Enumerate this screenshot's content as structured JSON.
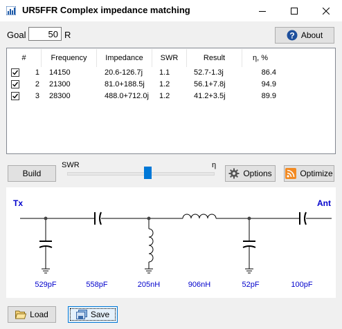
{
  "window": {
    "title": "UR5FFR Complex impedance matching",
    "app_icon": "bar-chart-icon"
  },
  "goal": {
    "label": "Goal",
    "value": "50",
    "unit": "R"
  },
  "about_button": {
    "label": "About",
    "icon": "help-icon"
  },
  "table": {
    "columns": [
      "#",
      "Frequency",
      "Impedance",
      "SWR",
      "Result",
      "η, %"
    ],
    "rows": [
      {
        "checked": true,
        "index": "1",
        "frequency": "14150",
        "impedance": "20.6-126.7j",
        "swr": "1.1",
        "result": "52.7-1.3j",
        "eta": "86.4"
      },
      {
        "checked": true,
        "index": "2",
        "frequency": "21300",
        "impedance": "81.0+188.5j",
        "swr": "1.2",
        "result": "56.1+7.8j",
        "eta": "94.9"
      },
      {
        "checked": true,
        "index": "3",
        "frequency": "28300",
        "impedance": "488.0+712.0j",
        "swr": "1.2",
        "result": "41.2+3.5j",
        "eta": "89.9"
      }
    ]
  },
  "controls": {
    "build_label": "Build",
    "swr_label": "SWR",
    "eta_label": "η",
    "slider_value": 0.55,
    "options_label": "Options",
    "options_icon": "gear-icon",
    "optimize_label": "Optimize",
    "optimize_icon": "rss-icon"
  },
  "schematic": {
    "tx_label": "Tx",
    "ant_label": "Ant",
    "components": [
      "529pF",
      "558pF",
      "205nH",
      "906nH",
      "52pF",
      "100pF"
    ]
  },
  "bottom": {
    "load_label": "Load",
    "load_icon": "folder-open-icon",
    "save_label": "Save",
    "save_icon": "save-icon"
  },
  "colors": {
    "accent": "#0078d7",
    "value_text": "#0000cc"
  }
}
